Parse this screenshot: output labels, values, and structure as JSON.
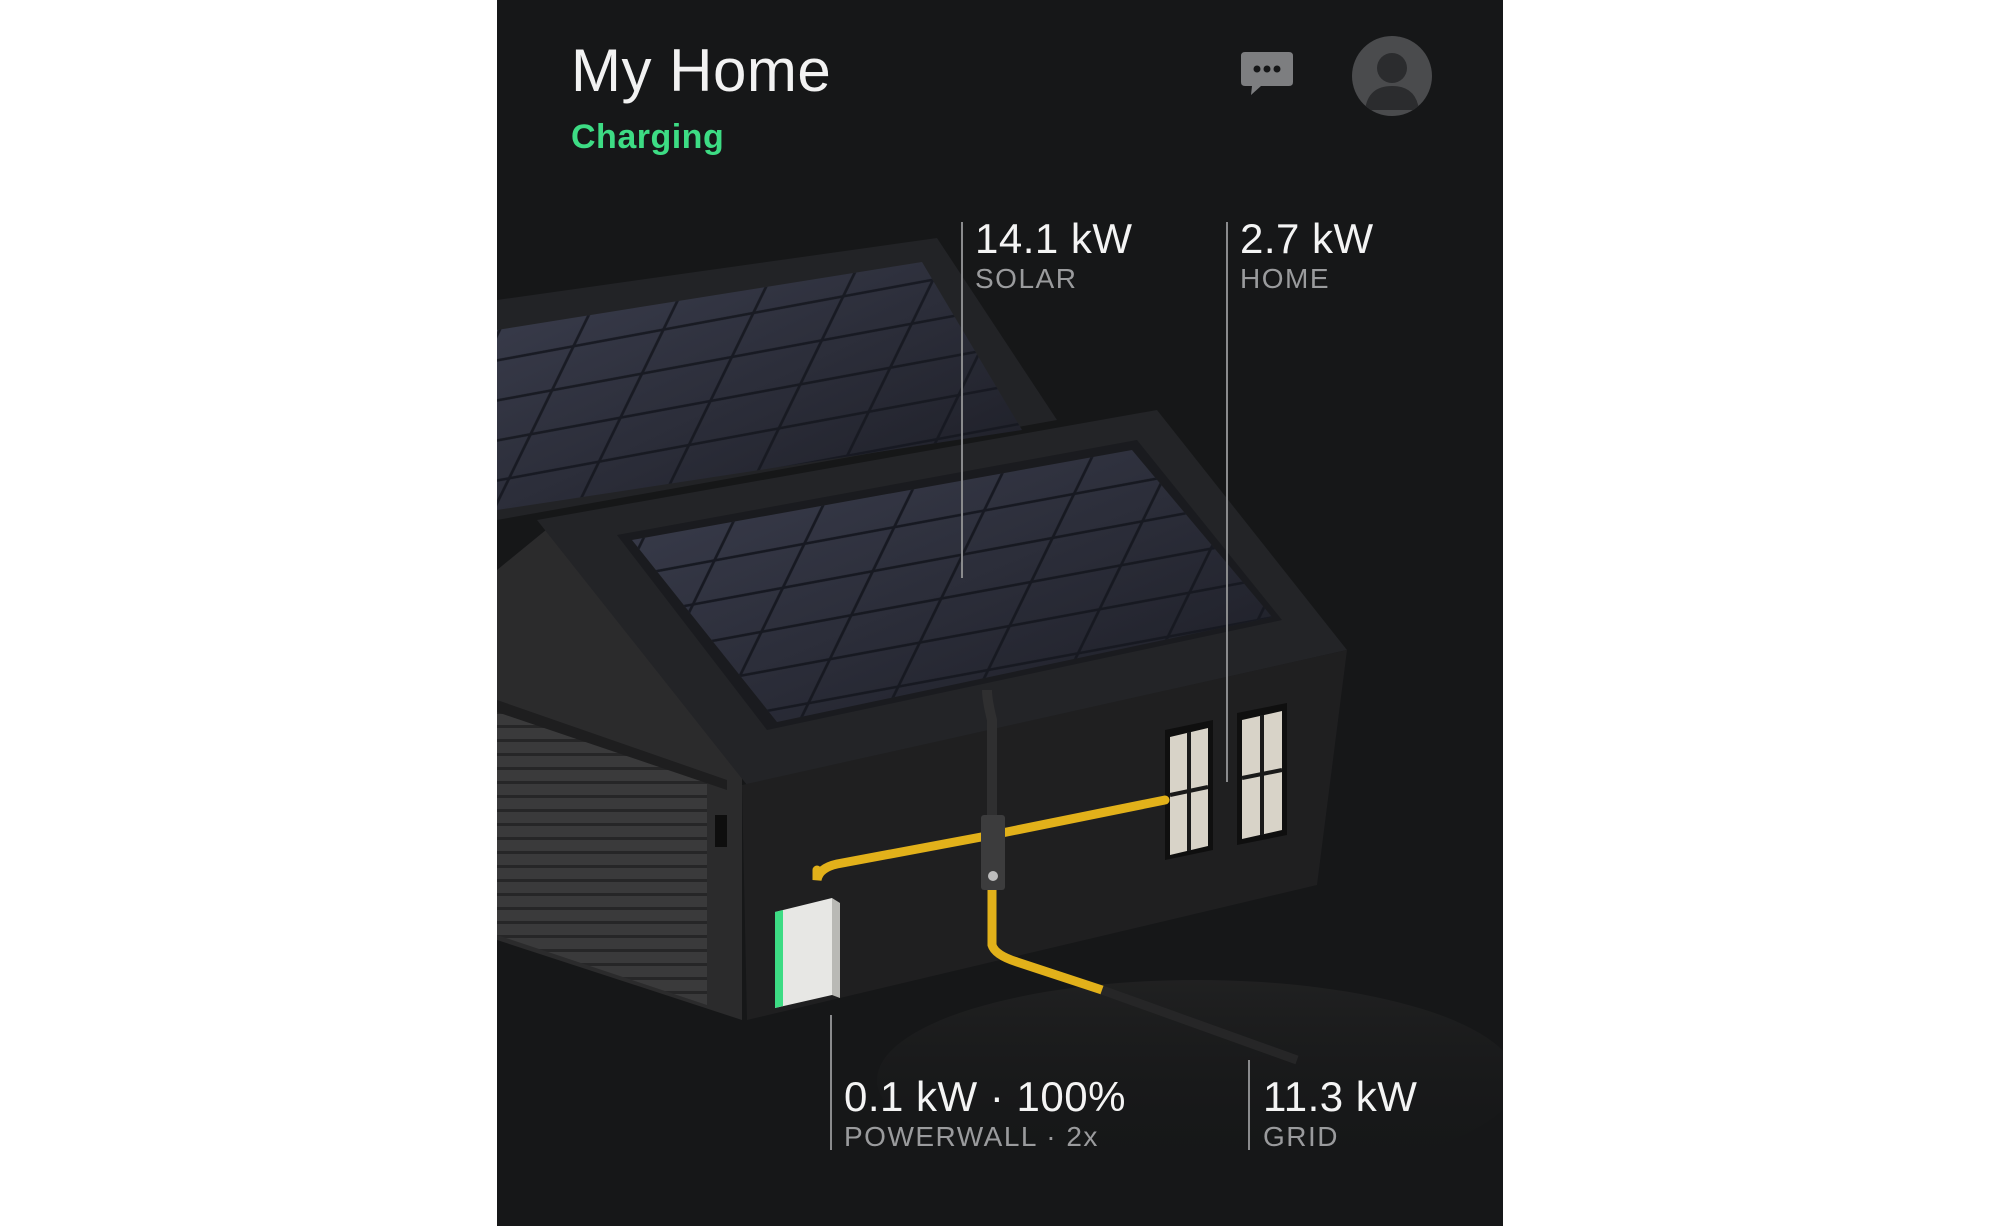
{
  "header": {
    "title": "My Home",
    "status": "Charging",
    "status_color": "#3ddc84"
  },
  "actions": {
    "chat_icon": "chat-bubble-icon",
    "profile_icon": "user-avatar-icon"
  },
  "metrics": {
    "solar": {
      "value": "14.1 kW",
      "label": "SOLAR"
    },
    "home": {
      "value": "2.7 kW",
      "label": "HOME"
    },
    "powerwall": {
      "value": "0.1 kW · 100%",
      "label": "POWERWALL · 2x"
    },
    "grid": {
      "value": "11.3 kW",
      "label": "GRID"
    }
  },
  "colors": {
    "background": "#161718",
    "accent_green": "#3ddc84",
    "power_flow": "#e2b11a"
  }
}
